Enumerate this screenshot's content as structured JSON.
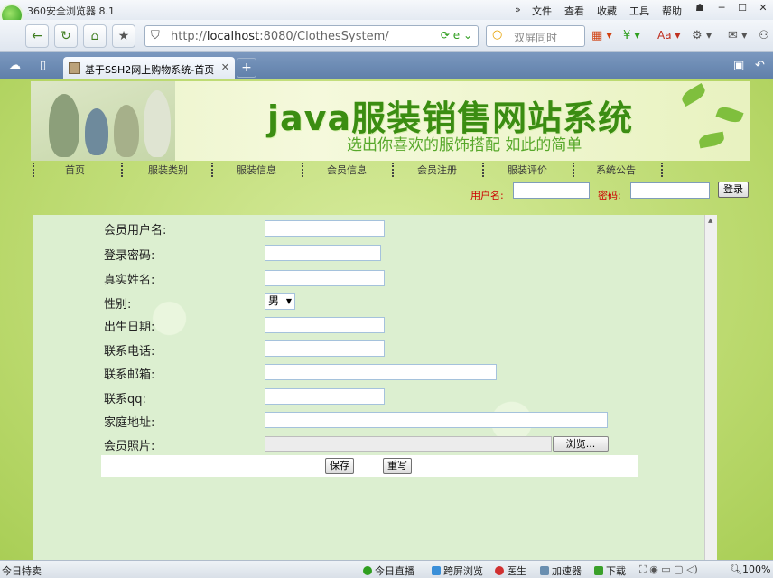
{
  "browser": {
    "title": "360安全浏览器 8.1",
    "menu": [
      "文件",
      "查看",
      "收藏",
      "工具",
      "帮助"
    ],
    "url_host": "http://",
    "url_domain": "localhost",
    "url_path": ":8080/ClothesSystem/",
    "search_placeholder": "双屏同时",
    "tab_title": "基于SSH2网上购物系统-首页"
  },
  "site": {
    "banner_title": "java服装销售网站系统",
    "banner_subtitle": "选出你喜欢的服饰搭配 如此的简单",
    "nav": [
      "首页",
      "服装类别",
      "服装信息",
      "会员信息",
      "会员注册",
      "服装评价",
      "系统公告"
    ],
    "login": {
      "username_label": "用户名:",
      "password_label": "密码:",
      "button": "登录"
    }
  },
  "form": {
    "fields": [
      {
        "label": "会员用户名:",
        "value": ""
      },
      {
        "label": "登录密码:",
        "value": ""
      },
      {
        "label": "真实姓名:",
        "value": ""
      },
      {
        "label": "性别:",
        "value": "男"
      },
      {
        "label": "出生日期:",
        "value": ""
      },
      {
        "label": "联系电话:",
        "value": ""
      },
      {
        "label": "联系邮箱:",
        "value": ""
      },
      {
        "label": "联系qq:",
        "value": ""
      },
      {
        "label": "家庭地址:",
        "value": ""
      },
      {
        "label": "会员照片:",
        "value": ""
      }
    ],
    "browse_button": "浏览...",
    "save_button": "保存",
    "reset_button": "重写"
  },
  "status": {
    "left": "今日特卖",
    "items": [
      "今日直播",
      "跨屏浏览",
      "医生",
      "加速器",
      "下载"
    ],
    "zoom": "100%"
  },
  "colors": {
    "accent_green": "#3b8d12",
    "login_red": "#cc0000"
  }
}
